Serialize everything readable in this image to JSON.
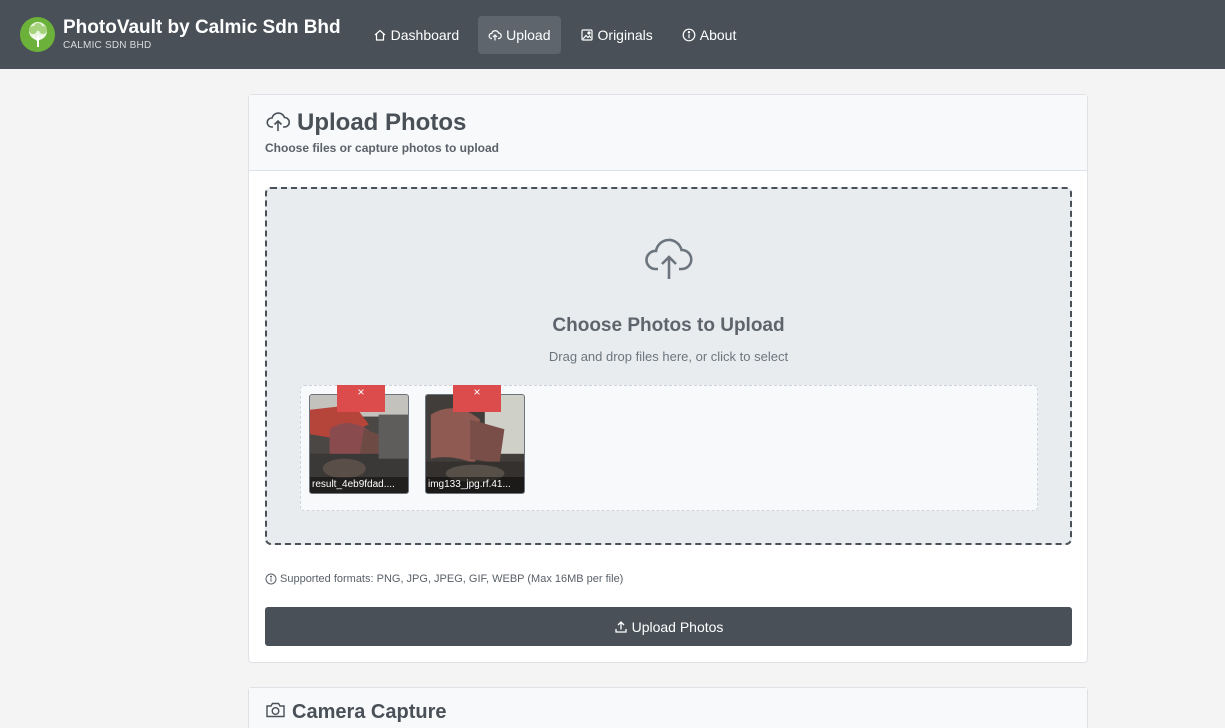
{
  "nav": {
    "brand_title": "PhotoVault by Calmic Sdn Bhd",
    "brand_sub": "CALMIC SDN BHD",
    "links": [
      {
        "label": "Dashboard",
        "icon": "home-icon"
      },
      {
        "label": "Upload",
        "icon": "cloud-upload-icon",
        "active": true
      },
      {
        "label": "Originals",
        "icon": "image-icon"
      },
      {
        "label": "About",
        "icon": "info-icon"
      }
    ]
  },
  "upload_card": {
    "title": "Upload Photos",
    "subtitle": "Choose files or capture photos to upload",
    "dropzone_title": "Choose Photos to Upload",
    "dropzone_sub": "Drag and drop files here, or click to select",
    "files": [
      {
        "name": "result_4eb9fdad....",
        "remove_label": "×"
      },
      {
        "name": "img133_jpg.rf.41...",
        "remove_label": "×"
      }
    ],
    "formats_note": "Supported formats: PNG, JPG, JPEG, GIF, WEBP (Max 16MB per file)",
    "upload_button": "Upload Photos"
  },
  "camera_card": {
    "title": "Camera Capture"
  },
  "colors": {
    "navbar": "#495057",
    "remove_button": "#dc4c4c",
    "brand_logo": "#6cb23a"
  }
}
